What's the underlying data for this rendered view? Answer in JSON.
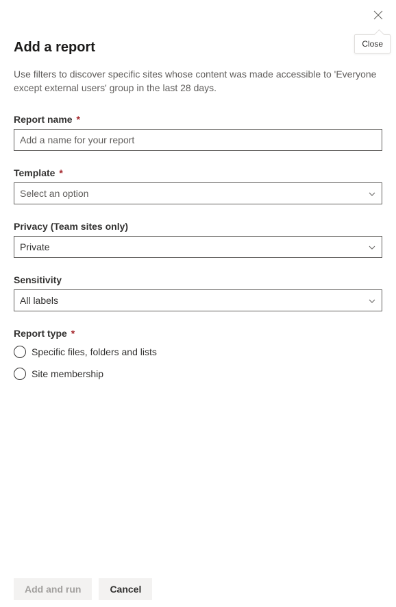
{
  "header": {
    "title": "Add a report",
    "subtitle": "Use filters to discover specific sites whose content was made accessible to 'Everyone except external users' group in the last 28 days.",
    "close_tooltip": "Close"
  },
  "fields": {
    "report_name": {
      "label": "Report name",
      "required": "*",
      "placeholder": "Add a name for your report",
      "value": ""
    },
    "template": {
      "label": "Template",
      "required": "*",
      "value": "Select an option"
    },
    "privacy": {
      "label": "Privacy (Team sites only)",
      "value": "Private"
    },
    "sensitivity": {
      "label": "Sensitivity",
      "value": "All labels"
    },
    "report_type": {
      "label": "Report type",
      "required": "*",
      "options": [
        "Specific files, folders and lists",
        "Site membership"
      ]
    }
  },
  "footer": {
    "primary": "Add and run",
    "secondary": "Cancel"
  }
}
